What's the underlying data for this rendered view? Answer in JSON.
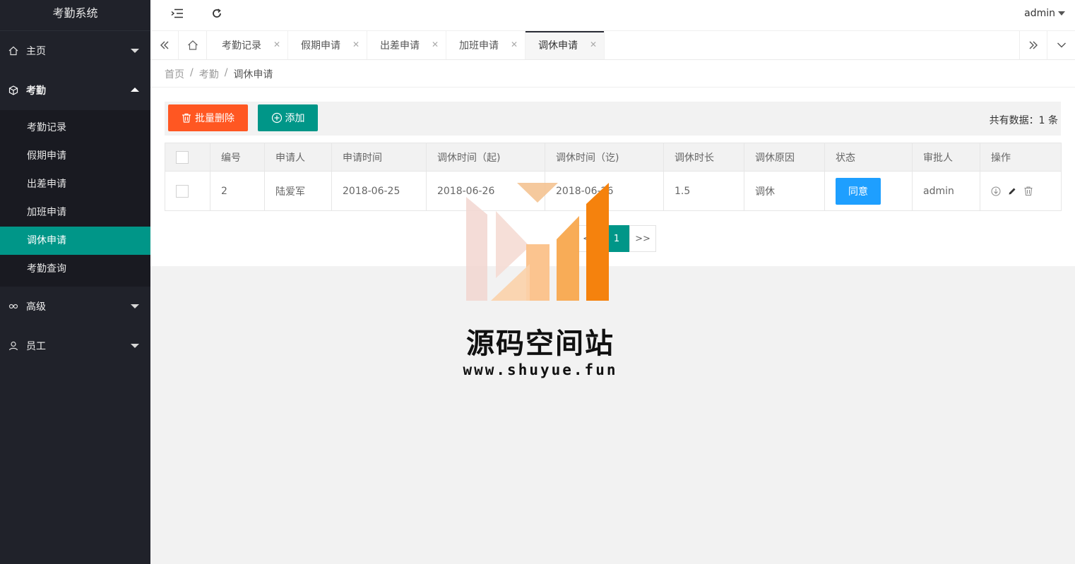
{
  "app": {
    "title": "考勤系统"
  },
  "sidebar": {
    "menus": [
      {
        "label": "主页"
      },
      {
        "label": "考勤"
      },
      {
        "label": "高级"
      },
      {
        "label": "员工"
      }
    ],
    "sub_items": [
      {
        "label": "考勤记录"
      },
      {
        "label": "假期申请"
      },
      {
        "label": "出差申请"
      },
      {
        "label": "加班申请"
      },
      {
        "label": "调休申请"
      },
      {
        "label": "考勤查询"
      }
    ]
  },
  "header": {
    "user": "admin"
  },
  "tabs": [
    {
      "label": "考勤记录"
    },
    {
      "label": "假期申请"
    },
    {
      "label": "出差申请"
    },
    {
      "label": "加班申请"
    },
    {
      "label": "调休申请"
    }
  ],
  "breadcrumb": {
    "home": "首页",
    "section": "考勤",
    "current": "调休申请",
    "sep": "/"
  },
  "toolbar": {
    "batch_delete": "批量删除",
    "add": "添加",
    "count_text": "共有数据：1 条"
  },
  "table": {
    "headers": [
      "编号",
      "申请人",
      "申请时间",
      "调休时间（起)",
      "调休时间（讫)",
      "调休时长",
      "调休原因",
      "状态",
      "审批人",
      "操作"
    ],
    "rows": [
      {
        "id": "2",
        "applicant": "陆爱军",
        "apply_time": "2018-06-25",
        "start": "2018-06-26",
        "end": "2018-06-26",
        "duration": "1.5",
        "reason": "调休",
        "status": "同意",
        "approver": "admin"
      }
    ]
  },
  "pager": {
    "prev": "<<",
    "current": "1",
    "next": ">>"
  },
  "watermark": {
    "title": "源码空间站",
    "url": "www.shuyue.fun"
  },
  "colors": {
    "accent": "#009688",
    "danger": "#ff5722",
    "blue": "#1e9fff",
    "sidebar": "#20222a"
  }
}
